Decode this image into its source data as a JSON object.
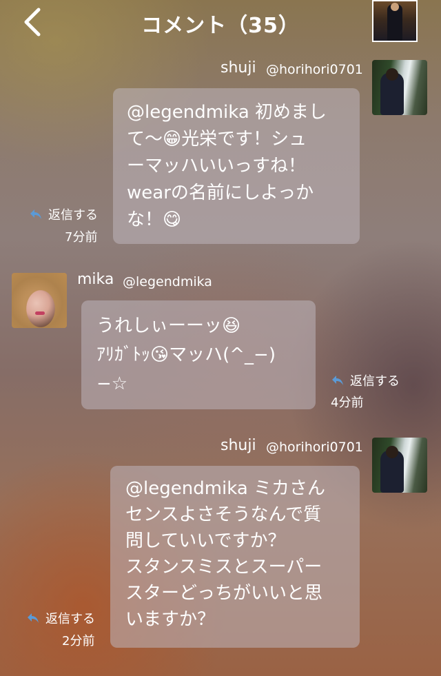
{
  "header": {
    "title": "コメント（35）"
  },
  "comments": [
    {
      "username": "shuji",
      "handle": "@horihori0701",
      "lines": [
        "@legendmika 初めまし",
        "て〜😁光栄です！シュ",
        "ーマッハいいっすね！",
        "wearの名前にしよっか",
        "な！😋"
      ],
      "reply_label": "返信する",
      "time": "7分前"
    },
    {
      "username": "mika",
      "handle": "@legendmika",
      "lines": [
        "うれしぃーーッ😆",
        "ｱﾘｶﾞﾄｯ😘マッハ(^_−)",
        "−☆"
      ],
      "reply_label": "返信する",
      "time": "4分前"
    },
    {
      "username": "shuji",
      "handle": "@horihori0701",
      "lines": [
        "@legendmika ミカさん",
        "センスよさそうなんで質",
        "問していいですか？",
        "スタンスミスとスーパー",
        "スターどっちがいいと思",
        "いますか？"
      ],
      "reply_label": "返信する",
      "time": "2分前"
    }
  ],
  "colors": {
    "reply_icon": "#5b9ad6",
    "bubble": "rgba(190,180,188,0.55)"
  }
}
